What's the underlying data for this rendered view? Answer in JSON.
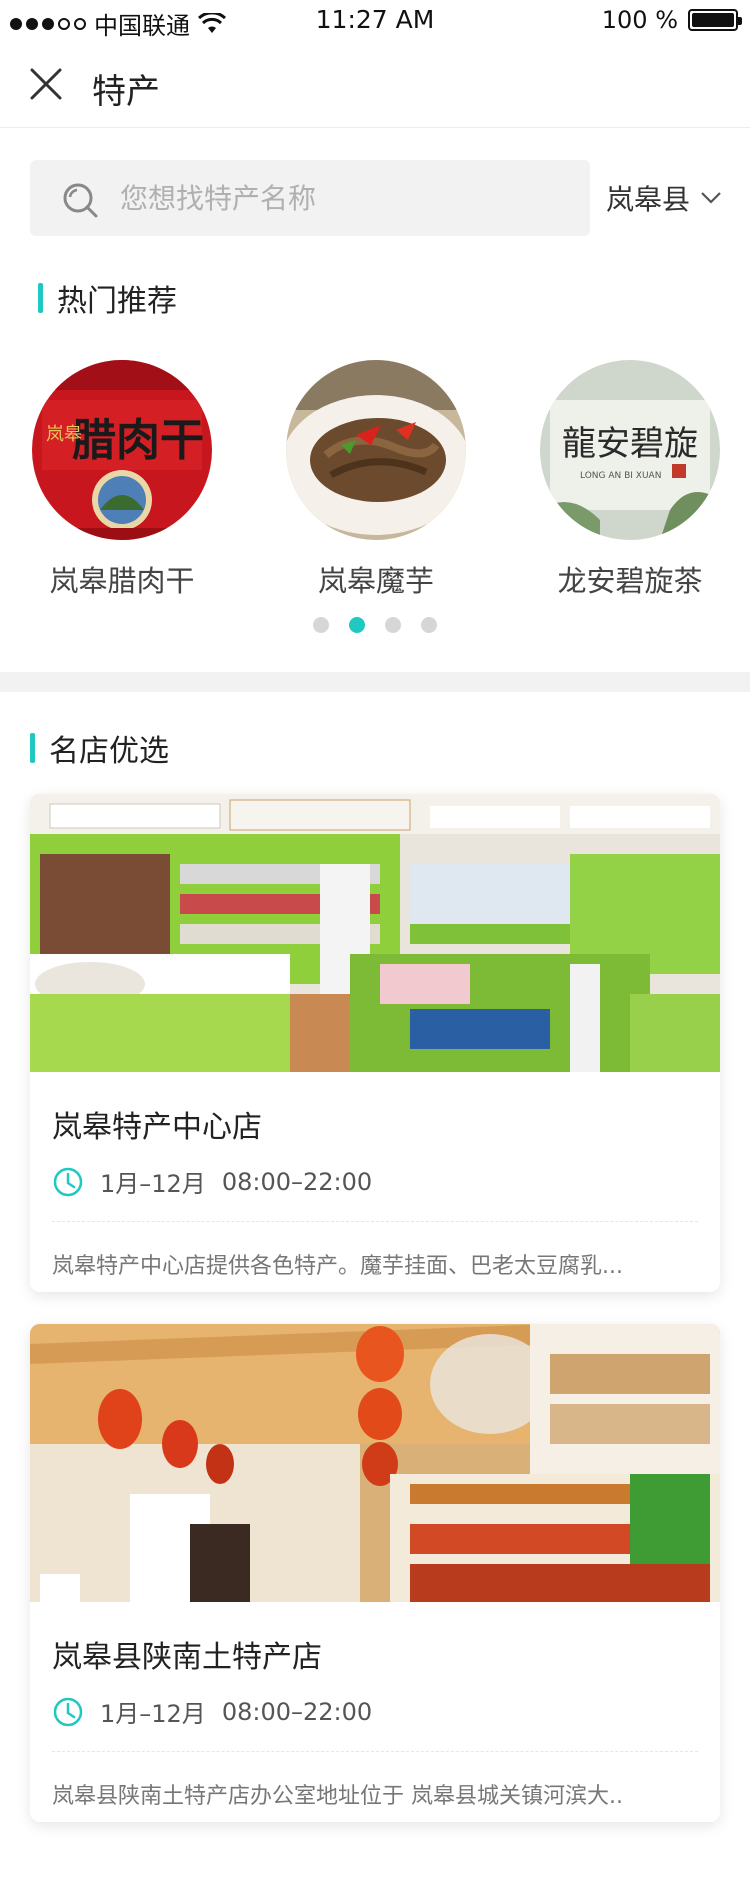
{
  "status_bar": {
    "carrier": "中国联通",
    "time": "11:27 AM",
    "battery": "100 %"
  },
  "nav": {
    "title": "特产"
  },
  "search": {
    "placeholder": "您想找特产名称",
    "region": "岚皋县"
  },
  "hot": {
    "title": "热门推荐",
    "items": [
      {
        "label": "岚皋腊肉干",
        "icon": "cured-meat-box"
      },
      {
        "label": "岚皋魔芋",
        "icon": "konjac-dish"
      },
      {
        "label": "龙安碧旋茶",
        "icon": "tea-package"
      }
    ],
    "pages": 4,
    "active_page": 2
  },
  "shops": {
    "title": "名店优选",
    "items": [
      {
        "name": "岚皋特产中心店",
        "months": "1月–12月",
        "hours": "08:00–22:00",
        "desc": "岚皋特产中心店提供各色特产。魔芋挂面、巴老太豆腐乳..."
      },
      {
        "name": "岚皋县陕南土特产店",
        "months": "1月–12月",
        "hours": "08:00–22:00",
        "desc": "岚皋县陕南土特产店办公室地址位于 岚皋县城关镇河滨大.."
      }
    ]
  },
  "colors": {
    "accent": "#1fc8c1",
    "background_band": "#f2f2f2"
  }
}
